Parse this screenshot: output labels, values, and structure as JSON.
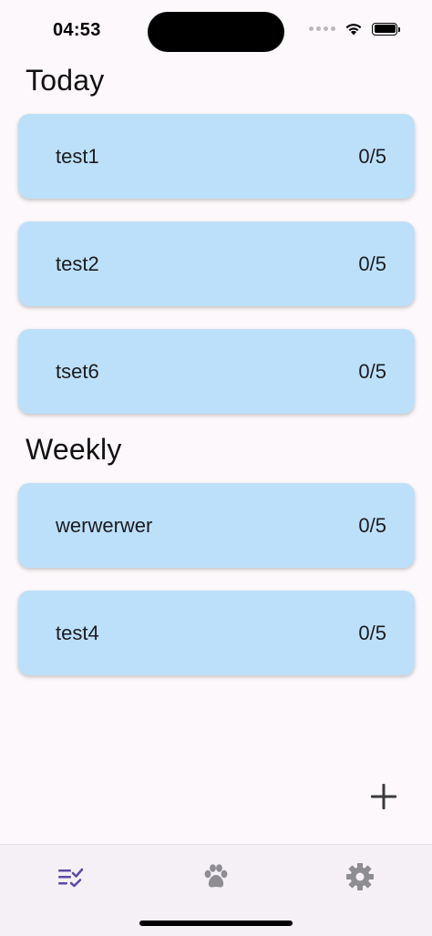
{
  "status_bar": {
    "time": "04:53"
  },
  "sections": [
    {
      "title": "Today",
      "tasks": [
        {
          "name": "test1",
          "progress": "0/5"
        },
        {
          "name": "test2",
          "progress": "0/5"
        },
        {
          "name": "tset6",
          "progress": "0/5"
        }
      ]
    },
    {
      "title": "Weekly",
      "tasks": [
        {
          "name": "werwerwer",
          "progress": "0/5"
        },
        {
          "name": "test4",
          "progress": "0/5"
        }
      ]
    }
  ],
  "fab": {
    "icon": "plus-icon"
  },
  "bottom_nav": {
    "items": [
      {
        "icon": "checklist-icon",
        "selected": true,
        "color": "#5b4ba6"
      },
      {
        "icon": "paw-icon",
        "selected": false,
        "color": "#8d8d92"
      },
      {
        "icon": "gear-icon",
        "selected": false,
        "color": "#8d8d92"
      }
    ]
  },
  "colors": {
    "card_background": "#bde0fa",
    "page_background": "#fdf8fb",
    "nav_background": "#f5eff6",
    "accent": "#5b4ba6"
  }
}
